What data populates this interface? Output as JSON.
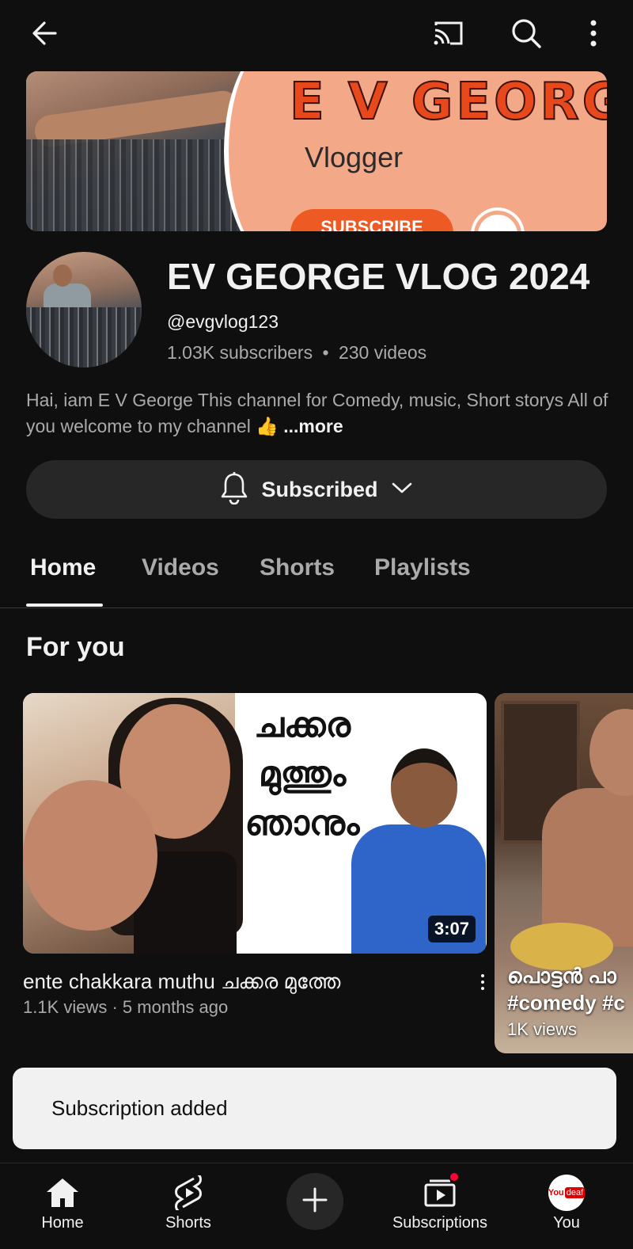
{
  "colors": {
    "background": "#0f0f0f",
    "surface": "#272727",
    "text": "#f1f1f1",
    "secondary_text": "#aaaaaa",
    "accent_red": "#ff0033"
  },
  "topbar": {
    "icons": [
      "back-arrow-icon",
      "cast-icon",
      "search-icon",
      "more-vert-icon"
    ]
  },
  "banner": {
    "title": "E V GEORG",
    "subtitle": "Vlogger",
    "button": "SUBSCRIBE"
  },
  "channel": {
    "title": "EV GEORGE VLOG 2024",
    "handle": "@evgvlog123",
    "subscribers": "1.03K subscribers",
    "separator": "•",
    "videos": "230 videos",
    "description": "Hai, iam E V George This channel for Comedy, music, Short storys All of you welcome to my channel 👍",
    "more": "...more"
  },
  "subscribe_button": {
    "label": "Subscribed"
  },
  "tabs": [
    {
      "label": "Home",
      "active": true
    },
    {
      "label": "Videos",
      "active": false
    },
    {
      "label": "Shorts",
      "active": false
    },
    {
      "label": "Playlists",
      "active": false
    }
  ],
  "section": {
    "title": "For you"
  },
  "video": {
    "thumb_text": [
      "ചക്കര",
      "മുത്തും",
      "ഞാനും"
    ],
    "duration": "3:07",
    "title": "ente chakkara muthu ചക്കര മുത്തേ",
    "meta": "1.1K views · 5 months ago"
  },
  "short": {
    "title_line1": "പൊട്ടൻ പാ",
    "title_line2": "#comedy #c",
    "views": "1K views"
  },
  "toast": {
    "message": "Subscription added"
  },
  "bottom_nav": {
    "home": "Home",
    "shorts": "Shorts",
    "subscriptions": "Subscriptions",
    "you": "You",
    "you_avatar_text": "You",
    "you_avatar_badge": "deaf"
  }
}
